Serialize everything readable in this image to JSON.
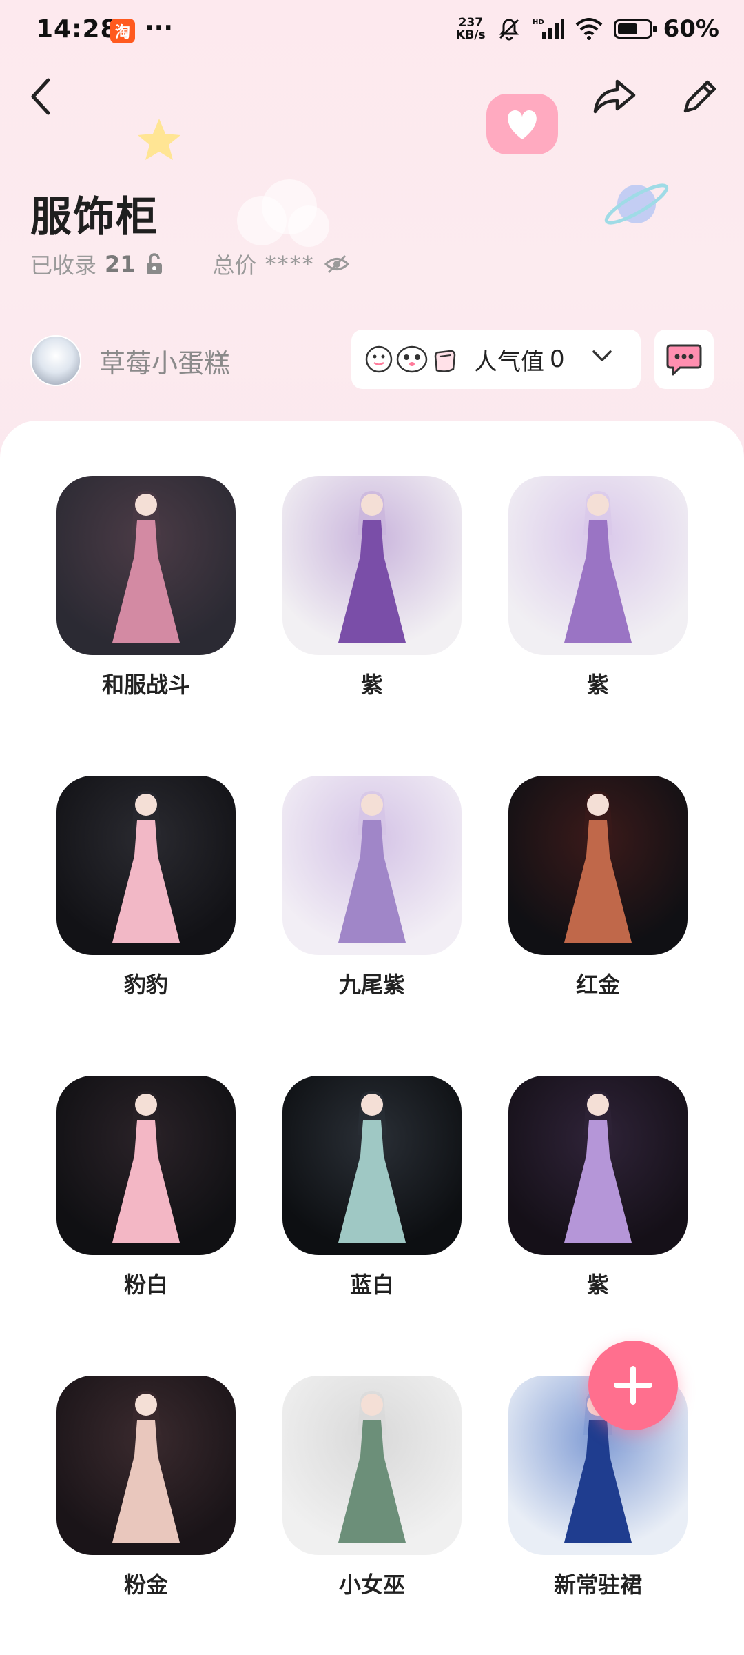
{
  "status_bar": {
    "time": "14:28",
    "app_badge": "淘",
    "more": "···",
    "net_speed_value": "237",
    "net_speed_unit": "KB/s",
    "battery_percent": "60%"
  },
  "header": {
    "title": "服饰柜",
    "collected_label": "已收录",
    "collected_count": "21",
    "total_price_label": "总价",
    "total_price_value": "****"
  },
  "user": {
    "name": "草莓小蛋糕",
    "popularity_label": "人气值",
    "popularity_value": "0"
  },
  "colors": {
    "accent": "#ff6f8e",
    "background_pink": "#fde9ee"
  },
  "outfits": [
    {
      "name": "和服战斗",
      "palette": [
        "#2b2a33",
        "#4b3b46",
        "#d38aa3"
      ]
    },
    {
      "name": "紫",
      "palette": [
        "#f2f0f3",
        "#c9b4dc",
        "#7a4ea8"
      ]
    },
    {
      "name": "紫",
      "palette": [
        "#f1eff3",
        "#d9c7ea",
        "#9a74c4"
      ]
    },
    {
      "name": "豹豹",
      "palette": [
        "#121216",
        "#2a2a30",
        "#f2b8c6"
      ]
    },
    {
      "name": "九尾紫",
      "palette": [
        "#f2eef5",
        "#d4c3e6",
        "#a086c8"
      ]
    },
    {
      "name": "红金",
      "palette": [
        "#101014",
        "#3b1a1a",
        "#c0684a"
      ]
    },
    {
      "name": "粉白",
      "palette": [
        "#101013",
        "#2a2228",
        "#f3b7c5"
      ]
    },
    {
      "name": "蓝白",
      "palette": [
        "#0d0f12",
        "#2a2f36",
        "#9fc8c4"
      ]
    },
    {
      "name": "紫",
      "palette": [
        "#151018",
        "#2f2338",
        "#b596d8"
      ]
    },
    {
      "name": "粉金",
      "palette": [
        "#1a1418",
        "#3a2a2e",
        "#e9c7bd"
      ]
    },
    {
      "name": "小女巫",
      "palette": [
        "#f0f0f0",
        "#d9d9d9",
        "#6c8f79"
      ]
    },
    {
      "name": "新常驻裙",
      "palette": [
        "#e9eef6",
        "#7f9bd4",
        "#1f3d8f"
      ]
    }
  ]
}
